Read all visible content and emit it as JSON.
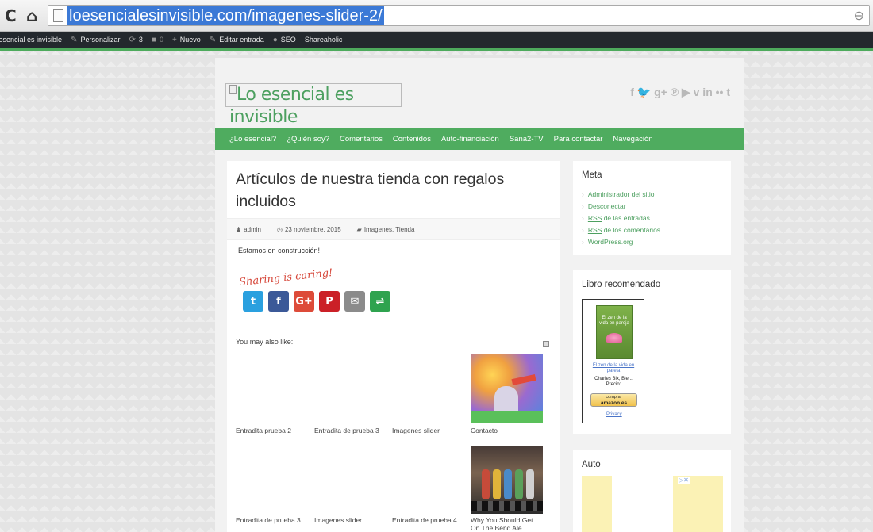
{
  "browser": {
    "url": "loesencialesinvisible.com/imagenes-slider-2/",
    "reload_glyph": "C",
    "home_glyph": "⌂",
    "zoom_glyph": "⊖"
  },
  "admin_bar": {
    "site_name": "Lo esencial es invisible",
    "customize": "Personalizar",
    "updates_count": "3",
    "comments_count": "0",
    "new": "Nuevo",
    "edit_post": "Editar entrada",
    "seo": "SEO",
    "shareaholic": "Shareaholic"
  },
  "site": {
    "logo_alt": "Lo esencial es invisible",
    "social_glyphs": "f 🐦 g+ ℗ ▶ v in •• t"
  },
  "nav": {
    "items": [
      "¿Lo esencial?",
      "¿Quién soy?",
      "Comentarios",
      "Contenidos",
      "Auto-financiación",
      "Sana2-TV",
      "Para contactar",
      "Navegación"
    ]
  },
  "post": {
    "title": "Artículos de nuestra tienda con regalos incluidos",
    "author": "admin",
    "date": "23 noviembre, 2015",
    "categories": "Imagenes, Tienda",
    "body": "¡Estamos en construcción!",
    "sharing_tagline": "Sharing is caring!",
    "share_buttons": [
      {
        "label": "t",
        "color": "#2aa0df"
      },
      {
        "label": "f",
        "color": "#3b5998"
      },
      {
        "label": "G+",
        "color": "#dd4b39"
      },
      {
        "label": "P",
        "color": "#cb2027"
      },
      {
        "label": "✉",
        "color": "#8b8b8b"
      },
      {
        "label": "⇌",
        "color": "#2fa34f"
      }
    ],
    "you_may_also_like": "You may also like:",
    "related_row1": [
      "Entradita prueba 2",
      "Entradita de prueba 3",
      "Imagenes slider",
      "Contacto"
    ],
    "related_row2": [
      "Entradita de prueba 3",
      "Imagenes slider",
      "Entradita de prueba 4",
      "Why You Should Get On The Bend Ale"
    ]
  },
  "sidebar": {
    "meta_title": "Meta",
    "meta_links": {
      "admin": "Administrador del sitio",
      "logout": "Desconectar",
      "rss_abbr": "RSS",
      "rss_entries": "de las entradas",
      "rss_comments": "de los comentarios",
      "wordpress": "WordPress.org"
    },
    "book_title": "Libro recomendado",
    "book": {
      "cover_text": "El zen de la vida en pareja",
      "link": "El zen de la vida en pareja",
      "author": "Charles Bix, Ble...",
      "price": "Precio:",
      "buy_line1": "comprar",
      "buy_line2": "amazon.es",
      "privacy": "Privacy"
    },
    "auto_title": "Auto",
    "ad_choices": "▷✕"
  }
}
